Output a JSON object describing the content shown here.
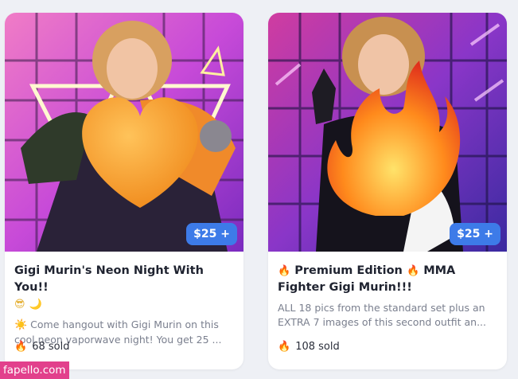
{
  "colors": {
    "price_badge": "#3d7be8",
    "background": "#eef0f5",
    "watermark_bg": "#e2408c"
  },
  "cards": [
    {
      "price": "$25 +",
      "title_text": "Gigi Murin's Neon Night With You!!",
      "title_emojis": [
        "😎",
        "🌙"
      ],
      "desc_emoji": "☀️",
      "description": "Come hangout with Gigi Murin on this cool neon vaporwave night! You get 25 ...",
      "sold": "68 sold",
      "sold_icon": "flame-icon",
      "image_overlay_icon": "orange-heart-emoji"
    },
    {
      "price": "$25 +",
      "title_emoji_before": "🔥",
      "title_part1": "Premium Edition",
      "title_emoji_mid": "🔥",
      "title_part2": "MMA Fighter Gigi Murin!!!",
      "description": "ALL 18 pics from the standard set plus an EXTRA 7 images of this second outfit an...",
      "sold": "108 sold",
      "sold_icon": "flame-icon",
      "image_overlay_icon": "fire-emoji"
    }
  ],
  "watermark": "fapello.com"
}
